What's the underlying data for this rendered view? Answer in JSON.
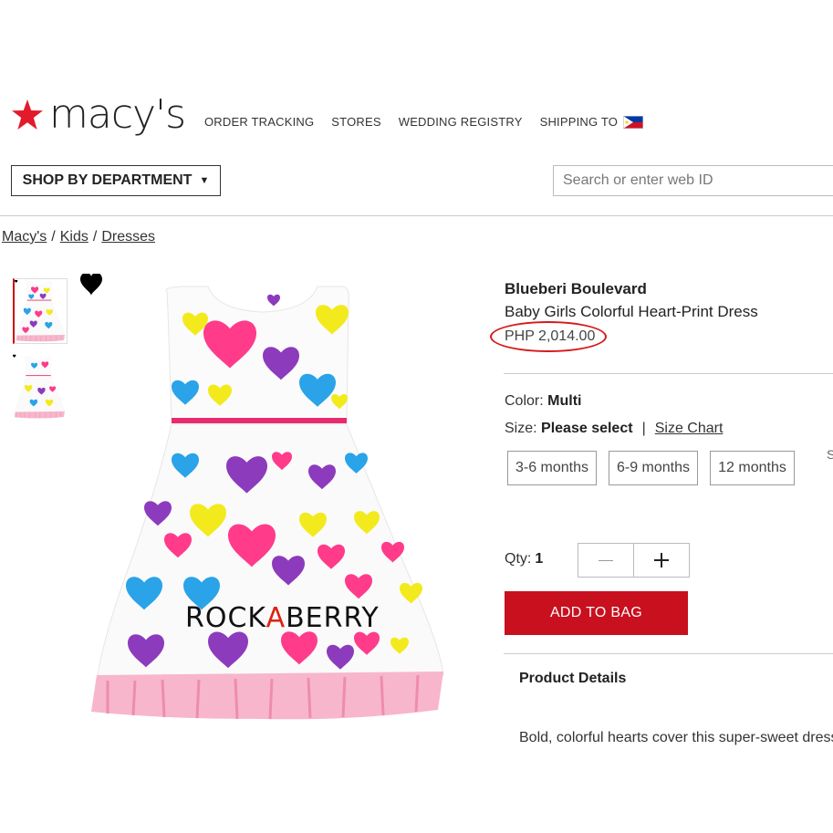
{
  "colors": {
    "brand_red": "#e21a2c",
    "add_to_bag": "#c8101f",
    "price_highlight": "#d51a1a"
  },
  "header": {
    "logo_text": "macy's",
    "nav": [
      "ORDER TRACKING",
      "STORES",
      "WEDDING REGISTRY",
      "SHIPPING TO"
    ],
    "shipping_flag": "philippines-flag-icon",
    "department_button": "SHOP BY DEPARTMENT",
    "search_placeholder": "Search or enter web ID"
  },
  "breadcrumb": [
    "Macy's",
    "Kids",
    "Dresses"
  ],
  "gallery": {
    "watermark": [
      "ROCK",
      "A",
      "BERRY"
    ]
  },
  "product": {
    "brand": "Blueberi Boulevard",
    "name": "Baby Girls Colorful Heart-Print Dress",
    "price": "PHP 2,014.00",
    "color_label": "Color:",
    "color_value": "Multi",
    "size_label": "Size:",
    "size_value": "Please select",
    "size_chart": "Size Chart",
    "sizes": [
      "3-6 months",
      "6-9 months",
      "12 months"
    ],
    "size_more": "S",
    "qty_label": "Qty:",
    "qty_value": "1",
    "add_to_bag": "ADD TO BAG",
    "details_heading": "Product Details",
    "description": "Bold, colorful hearts cover this super-sweet dress"
  }
}
